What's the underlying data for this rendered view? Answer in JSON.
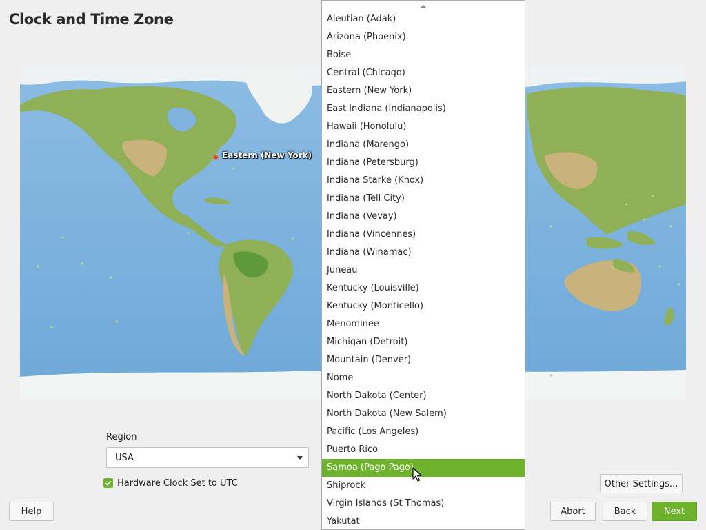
{
  "page": {
    "title": "Clock and Time Zone"
  },
  "map": {
    "location_label": "Eastern (New York)",
    "marker_color": "#c7501e",
    "ocean_color": "#7fb2dc",
    "land_color": "#8fb056"
  },
  "region": {
    "label": "Region",
    "selected": "USA"
  },
  "hardware_clock": {
    "label": "Hardware Clock Set to UTC",
    "checked": true
  },
  "timezone_list": {
    "items": [
      "Aleutian (Adak)",
      "Arizona (Phoenix)",
      "Boise",
      "Central (Chicago)",
      "Eastern (New York)",
      "East Indiana (Indianapolis)",
      "Hawaii (Honolulu)",
      "Indiana (Marengo)",
      "Indiana (Petersburg)",
      "Indiana Starke (Knox)",
      "Indiana (Tell City)",
      "Indiana (Vevay)",
      "Indiana (Vincennes)",
      "Indiana (Winamac)",
      "Juneau",
      "Kentucky (Louisville)",
      "Kentucky (Monticello)",
      "Menominee",
      "Michigan (Detroit)",
      "Mountain (Denver)",
      "Nome",
      "North Dakota (Center)",
      "North Dakota (New Salem)",
      "Pacific (Los Angeles)",
      "Puerto Rico",
      "Samoa (Pago Pago)",
      "Shiprock",
      "Virgin Islands (St Thomas)",
      "Yakutat"
    ],
    "selected": "Samoa (Pago Pago)",
    "highlight_color": "#6eb22d"
  },
  "buttons": {
    "other_settings": "Other Settings...",
    "help": "Help",
    "abort": "Abort",
    "back": "Back",
    "next": "Next"
  },
  "colors": {
    "accent": "#6eb22d",
    "background": "#efefef"
  }
}
